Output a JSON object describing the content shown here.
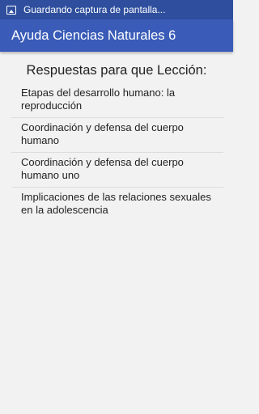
{
  "status_bar": {
    "notification_icon": "screenshot-icon",
    "text": "Guardando captura de pantalla..."
  },
  "app_bar": {
    "title": "Ayuda Ciencias Naturales 6"
  },
  "main": {
    "heading": "Respuestas para que Lección:",
    "lessons": [
      {
        "label": "Etapas del desarrollo humano: la reproducción"
      },
      {
        "label": "Coordinación y defensa del cuerpo humano"
      },
      {
        "label": "Coordinación y defensa del cuerpo humano uno"
      },
      {
        "label": "Implicaciones de las relaciones sexuales en la adolescencia"
      }
    ]
  },
  "colors": {
    "status_bar": "#2f4f9e",
    "app_bar": "#3a5cb8",
    "background": "#f2f2f2"
  }
}
